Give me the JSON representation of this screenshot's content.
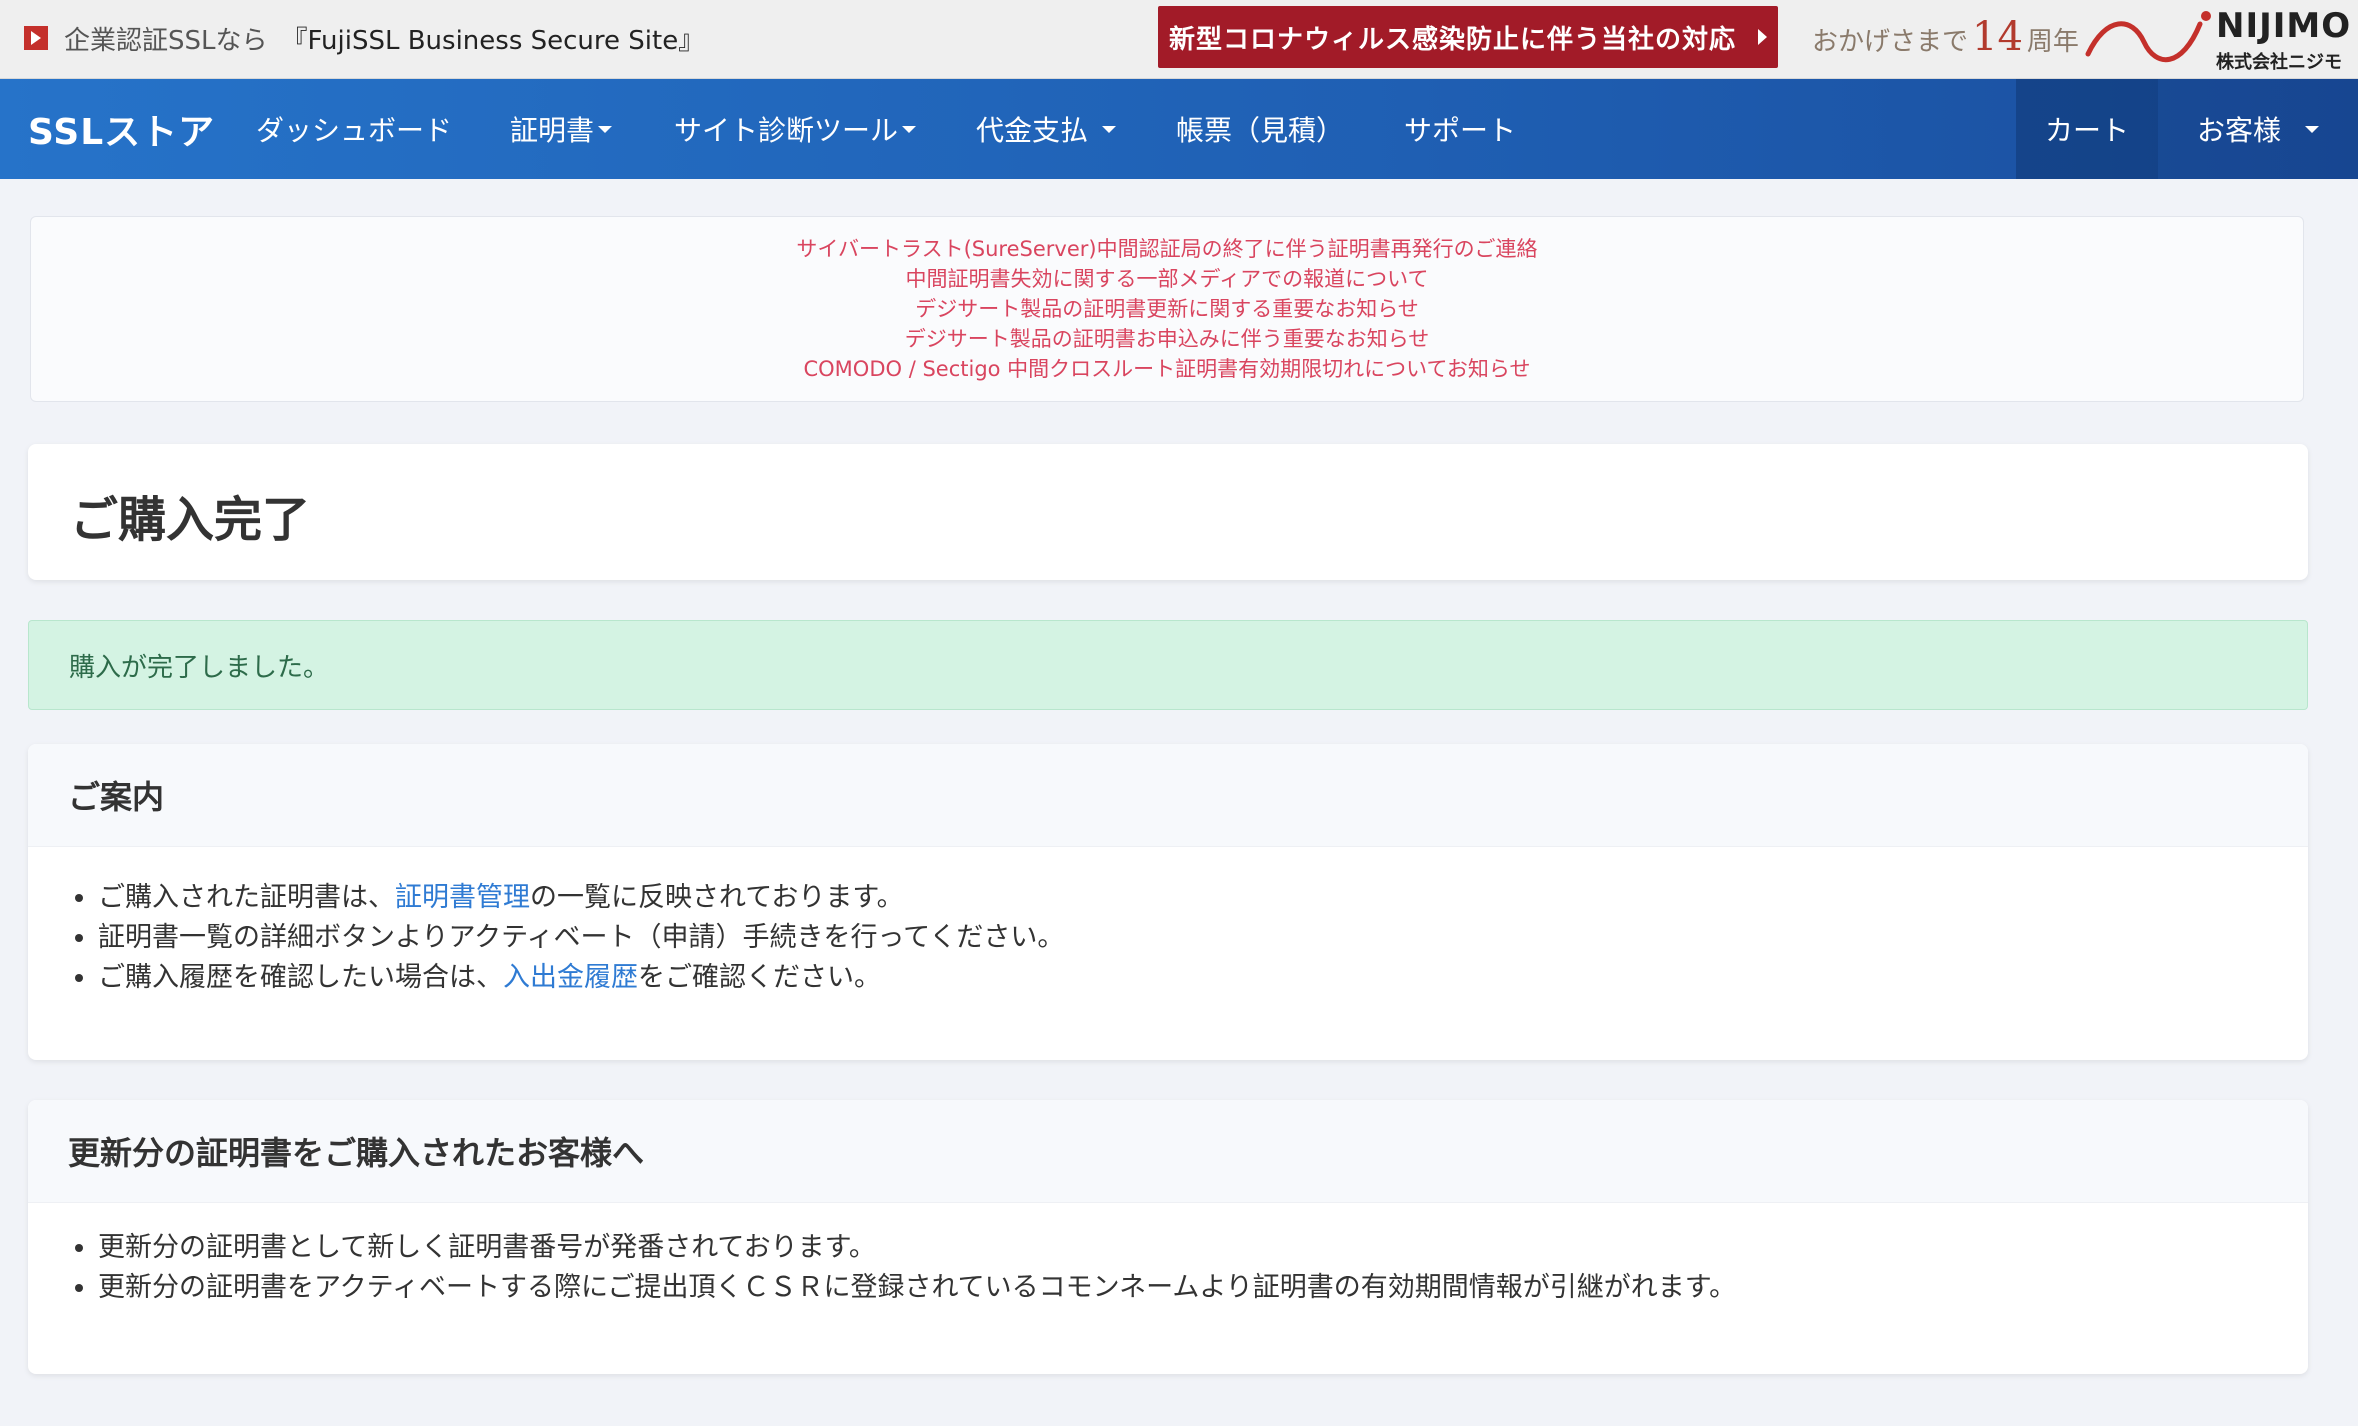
{
  "topbar": {
    "promo_label": "企業認証SSLなら",
    "promo_product": "『FujiSSL Business Secure Site』",
    "covid_button": "新型コロナウィルス感染防止に伴う当社の対応",
    "anniv_prefix": "おかげさまで",
    "anniv_number": "14",
    "anniv_suffix": "周年",
    "company_name": "NIJIMO",
    "company_corp": "株式会社ニジモ"
  },
  "nav": {
    "brand": "SSLストア",
    "items": [
      "ダッシュボード",
      "証明書",
      "サイト診断ツール",
      "代金支払",
      "帳票（見積）",
      "サポート"
    ],
    "cart": "カート",
    "account": "お客様"
  },
  "notices": [
    "サイバートラスト(SureServer)中間認証局の終了に伴う証明書再発行のご連絡",
    "中間証明書失効に関する一部メディアでの報道について",
    "デジサート製品の証明書更新に関する重要なお知らせ",
    "デジサート製品の証明書お申込みに伴う重要なお知らせ",
    "COMODO / Sectigo 中間クロスルート証明書有効期限切れについてお知らせ"
  ],
  "page_title": "ご購入完了",
  "alert": "購入が完了しました。",
  "guide": {
    "title": "ご案内",
    "item1_pre": "ご購入された証明書は、",
    "item1_link": "証明書管理",
    "item1_post": "の一覧に反映されております。",
    "item2": "証明書一覧の詳細ボタンよりアクティベート（申請）手続きを行ってください。",
    "item3_pre": "ご購入履歴を確認したい場合は、",
    "item3_link": "入出金履歴",
    "item3_post": "をご確認ください。"
  },
  "renewal": {
    "title": "更新分の証明書をご購入されたお客様へ",
    "item1": "更新分の証明書として新しく証明書番号が発番されております。",
    "item2": "更新分の証明書をアクティベートする際にご提出頂くＣＳＲに登録されているコモンネームより証明書の有効期間情報が引継がれます。"
  },
  "colors": {
    "nav_blue": "#2673c9",
    "covid_red": "#a21b28",
    "notice_red": "#d9455f",
    "link_blue": "#2f7bd3",
    "alert_green_bg": "#d4f3e3"
  }
}
